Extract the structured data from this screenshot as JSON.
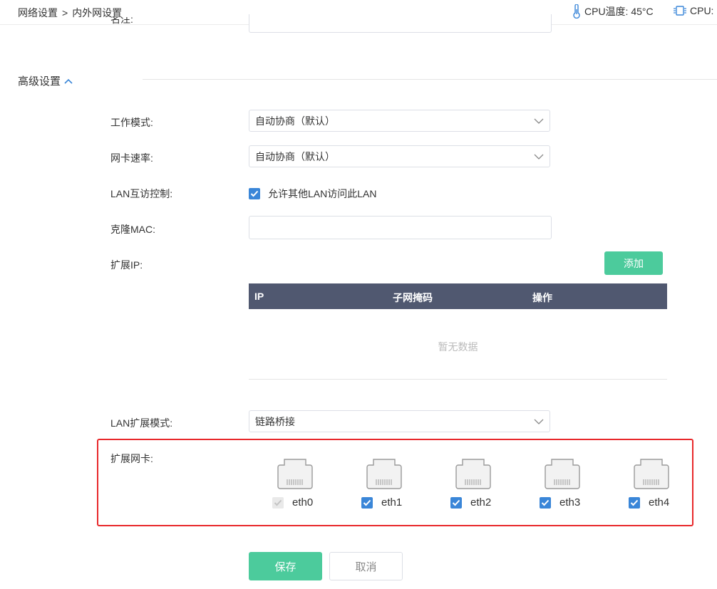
{
  "breadcrumb": {
    "parent": "网络设置",
    "separator": ">",
    "current": "内外网设置"
  },
  "status": {
    "cpu_temp": "CPU温度: 45°C",
    "cpu_usage": "CPU:"
  },
  "cutoff_field": {
    "label": "名注:"
  },
  "advanced": {
    "title": "高级设置",
    "work_mode": {
      "label": "工作模式:",
      "value": "自动协商（默认）"
    },
    "nic_speed": {
      "label": "网卡速率:",
      "value": "自动协商（默认）"
    },
    "lan_access": {
      "label": "LAN互访控制:",
      "checkbox_label": "允许其他LAN访问此LAN",
      "checked": true
    },
    "clone_mac": {
      "label": "克隆MAC:",
      "value": ""
    },
    "ext_ip": {
      "label": "扩展IP:",
      "add_button": "添加",
      "columns": [
        "IP",
        "子网掩码",
        "操作"
      ],
      "empty_text": "暂无数据"
    },
    "lan_ext_mode": {
      "label": "LAN扩展模式:",
      "value": "链路桥接"
    },
    "ext_nic": {
      "label": "扩展网卡:",
      "ports": [
        {
          "name": "eth0",
          "checked": true,
          "disabled": true
        },
        {
          "name": "eth1",
          "checked": true,
          "disabled": false
        },
        {
          "name": "eth2",
          "checked": true,
          "disabled": false
        },
        {
          "name": "eth3",
          "checked": true,
          "disabled": false
        },
        {
          "name": "eth4",
          "checked": true,
          "disabled": false
        }
      ]
    }
  },
  "actions": {
    "save": "保存",
    "cancel": "取消"
  },
  "colors": {
    "accent_green": "#4ccb9c",
    "checkbox_blue": "#3a86d8",
    "table_header": "#505870",
    "highlight_red": "#e8282b"
  }
}
